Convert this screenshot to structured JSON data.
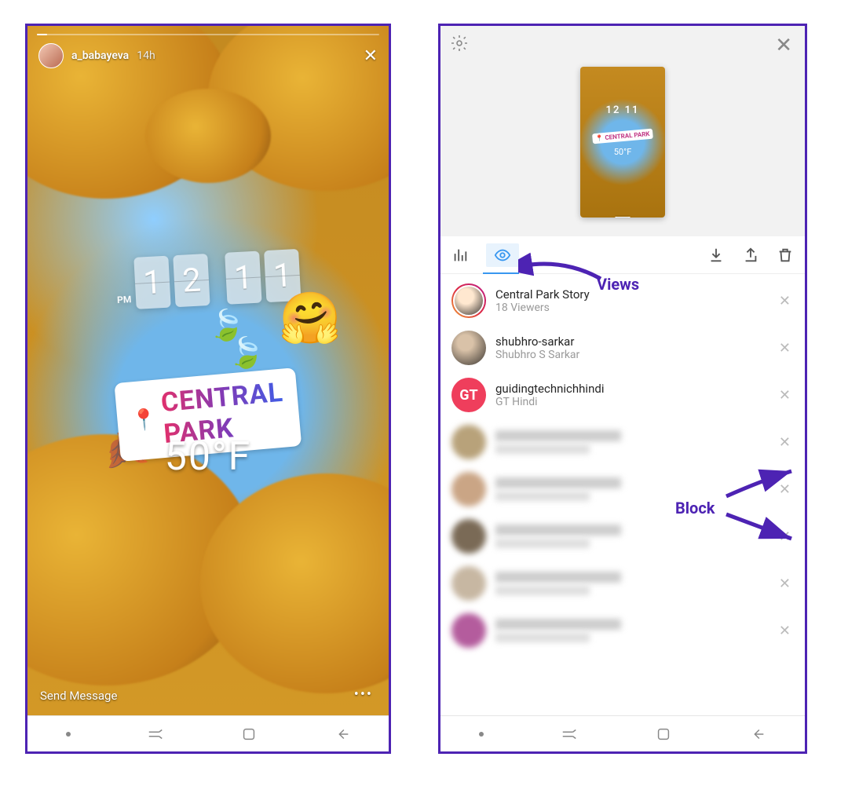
{
  "left": {
    "username": "a_babayeva",
    "timestamp": "14h",
    "clock": {
      "pm": "PM",
      "d1": "1",
      "d2": "2",
      "d3": "1",
      "d4": "1"
    },
    "location": "CENTRAL PARK",
    "temperature": "50°F",
    "send_message": "Send Message"
  },
  "right": {
    "thumb": {
      "clock": "12 11",
      "location": "CENTRAL PARK",
      "temp": "50°F"
    },
    "summary": {
      "title": "Central Park Story",
      "subtitle": "18 Viewers"
    },
    "viewers": [
      {
        "name": "shubhro-sarkar",
        "sub": "Shubhro S Sarkar"
      },
      {
        "name": "guidingtechnichhindi",
        "sub": "GT Hindi"
      }
    ],
    "gt_badge": "GT"
  },
  "annotations": {
    "views": "Views",
    "block": "Block"
  }
}
